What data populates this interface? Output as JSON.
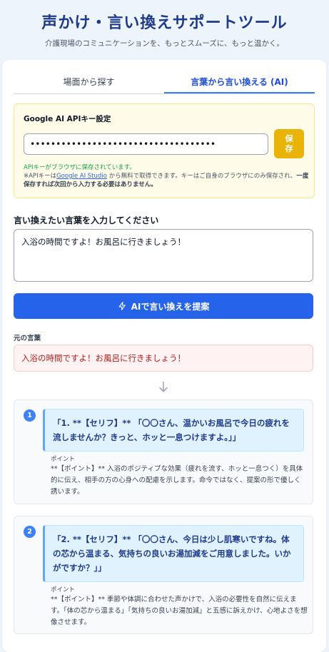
{
  "header": {
    "title": "声かけ・言い換えサポートツール",
    "subtitle": "介護現場のコミュニケーションを、もっとスムーズに、もっと温かく。"
  },
  "tabs": [
    {
      "label": "場面から探す",
      "active": false
    },
    {
      "label": "言葉から言い換える (AI)",
      "active": true
    }
  ],
  "api": {
    "title": "Google AI APIキー設定",
    "key_value": "••••••••••••••••••••••••••••••••••••",
    "save_label": "保存",
    "saved_message": "APIキーがブラウザに保存されています。",
    "note_prefix": "※APIキーは",
    "note_link": "Google AI Studio",
    "note_middle": "から無料で取得できます。キーはご自身のブラウザにのみ保存され、",
    "note_bold": "一度保存すれば次回から入力する必要はありません。"
  },
  "input": {
    "label": "言い換えたい言葉を入力してください",
    "value": "入浴の時間ですよ！お風呂に行きましょう！"
  },
  "suggest_button": {
    "label": "AIで言い換えを提案",
    "icon": "lightning-icon"
  },
  "original": {
    "label": "元の言葉",
    "text": "入浴の時間ですよ！お風呂に行きましょう！"
  },
  "suggestions": [
    {
      "number": "1",
      "quote": "「1. **【セリフ】** 「〇〇さん、温かいお風呂で今日の疲れを流しませんか？きっと、ホッと一息つけますよ。」」",
      "point_label": "ポイント",
      "point": "**【ポイント】** 入浴のポジティブな効果（疲れを流す、ホッと一息つく）を具体的に伝え、相手の方の心身への配慮を示します。命令ではなく、提案の形で優しく誘います。"
    },
    {
      "number": "2",
      "quote": "「2. **【セリフ】** 「〇〇さん、今日は少し肌寒いですね。体の芯から温まる、気持ちの良いお湯加減をご用意しました。いかがですか？」」",
      "point_label": "ポイント",
      "point": "**【ポイント】** 季節や体調に合わせた声かけで、入浴の必要性を自然に伝えます。「体の芯から温まる」「気持ちの良いお湯加減」と五感に訴えかけ、心地よさを想像させます。"
    }
  ],
  "colors": {
    "primary": "#2563eb",
    "title": "#1e3a8a",
    "save": "#eab308",
    "error_bg": "#fef2f2",
    "error_text": "#b91c1c"
  }
}
